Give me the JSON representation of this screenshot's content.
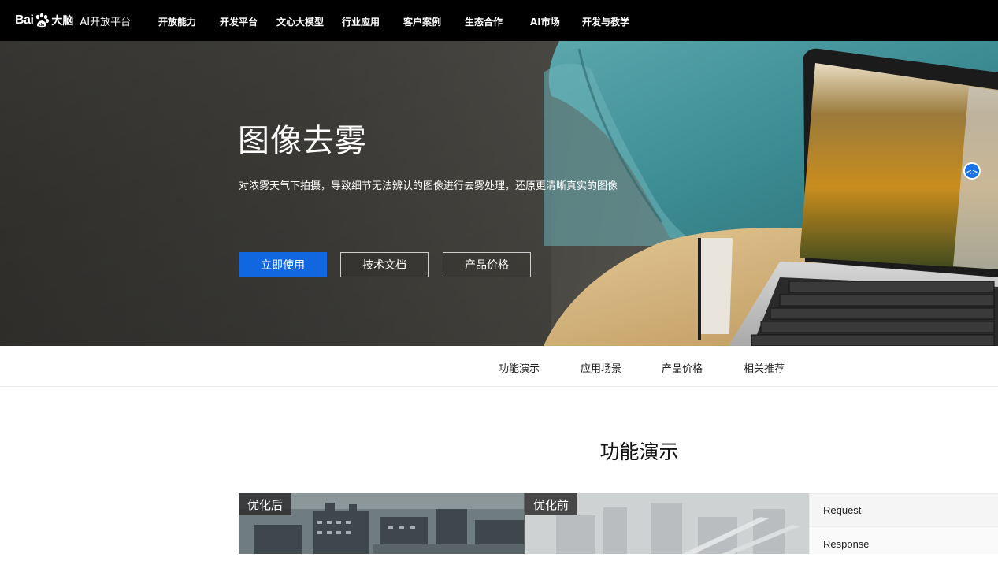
{
  "brand": {
    "logo_bai": "Bai",
    "logo_dnao": "大脑",
    "platform": "AI开放平台"
  },
  "topnav": {
    "items": [
      {
        "label": "开放能力"
      },
      {
        "label": "开发平台"
      },
      {
        "label": "文心大模型"
      },
      {
        "label": "行业应用"
      },
      {
        "label": "客户案例"
      },
      {
        "label": "生态合作"
      },
      {
        "label": "AI市场"
      },
      {
        "label": "开发与教学"
      }
    ]
  },
  "hero": {
    "title": "图像去雾",
    "subtitle": "对浓雾天气下拍摄，导致细节无法辨认的图像进行去雾处理，还原更清晰真实的图像",
    "buttons": {
      "use": "立即使用",
      "docs": "技术文档",
      "price": "产品价格"
    }
  },
  "subnav": {
    "items": [
      {
        "label": "功能演示"
      },
      {
        "label": "应用场景"
      },
      {
        "label": "产品价格"
      },
      {
        "label": "相关推荐"
      }
    ]
  },
  "demo": {
    "section_title": "功能演示",
    "after_label": "优化后",
    "before_label": "优化前",
    "request_label": "Request",
    "response_label": "Response"
  },
  "colors": {
    "primary": "#1067e0",
    "topnav_bg": "#000000",
    "chair": "#3f8f96",
    "table": "#d3b279"
  }
}
